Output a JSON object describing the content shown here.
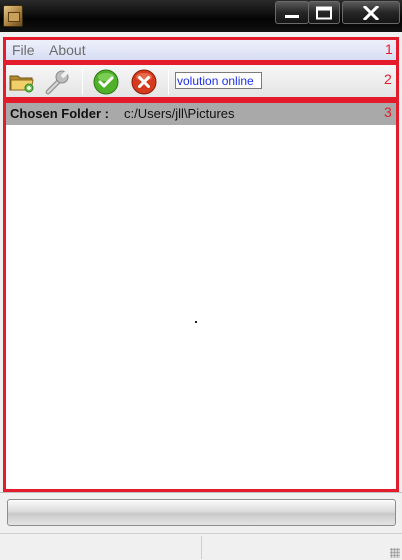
{
  "window": {
    "title": "",
    "controls": [
      "minimize",
      "maximize",
      "close"
    ]
  },
  "menubar": {
    "items": [
      {
        "label": "File"
      },
      {
        "label": "About"
      }
    ]
  },
  "toolbar": {
    "buttons": [
      {
        "icon": "open-folder-icon"
      },
      {
        "icon": "settings-wrench-icon"
      },
      {
        "icon": "green-check-icon"
      },
      {
        "icon": "red-x-icon"
      }
    ],
    "search_value": "volution online"
  },
  "content": {
    "folder_label": "Chosen Folder :",
    "folder_path": "c:/Users/jll\\Pictures"
  },
  "annotations": {
    "menubar": "1",
    "toolbar": "2",
    "content": "3",
    "color": "#e41b2a"
  },
  "progress": {
    "value": 0
  },
  "status": {
    "left": "",
    "right": ""
  }
}
